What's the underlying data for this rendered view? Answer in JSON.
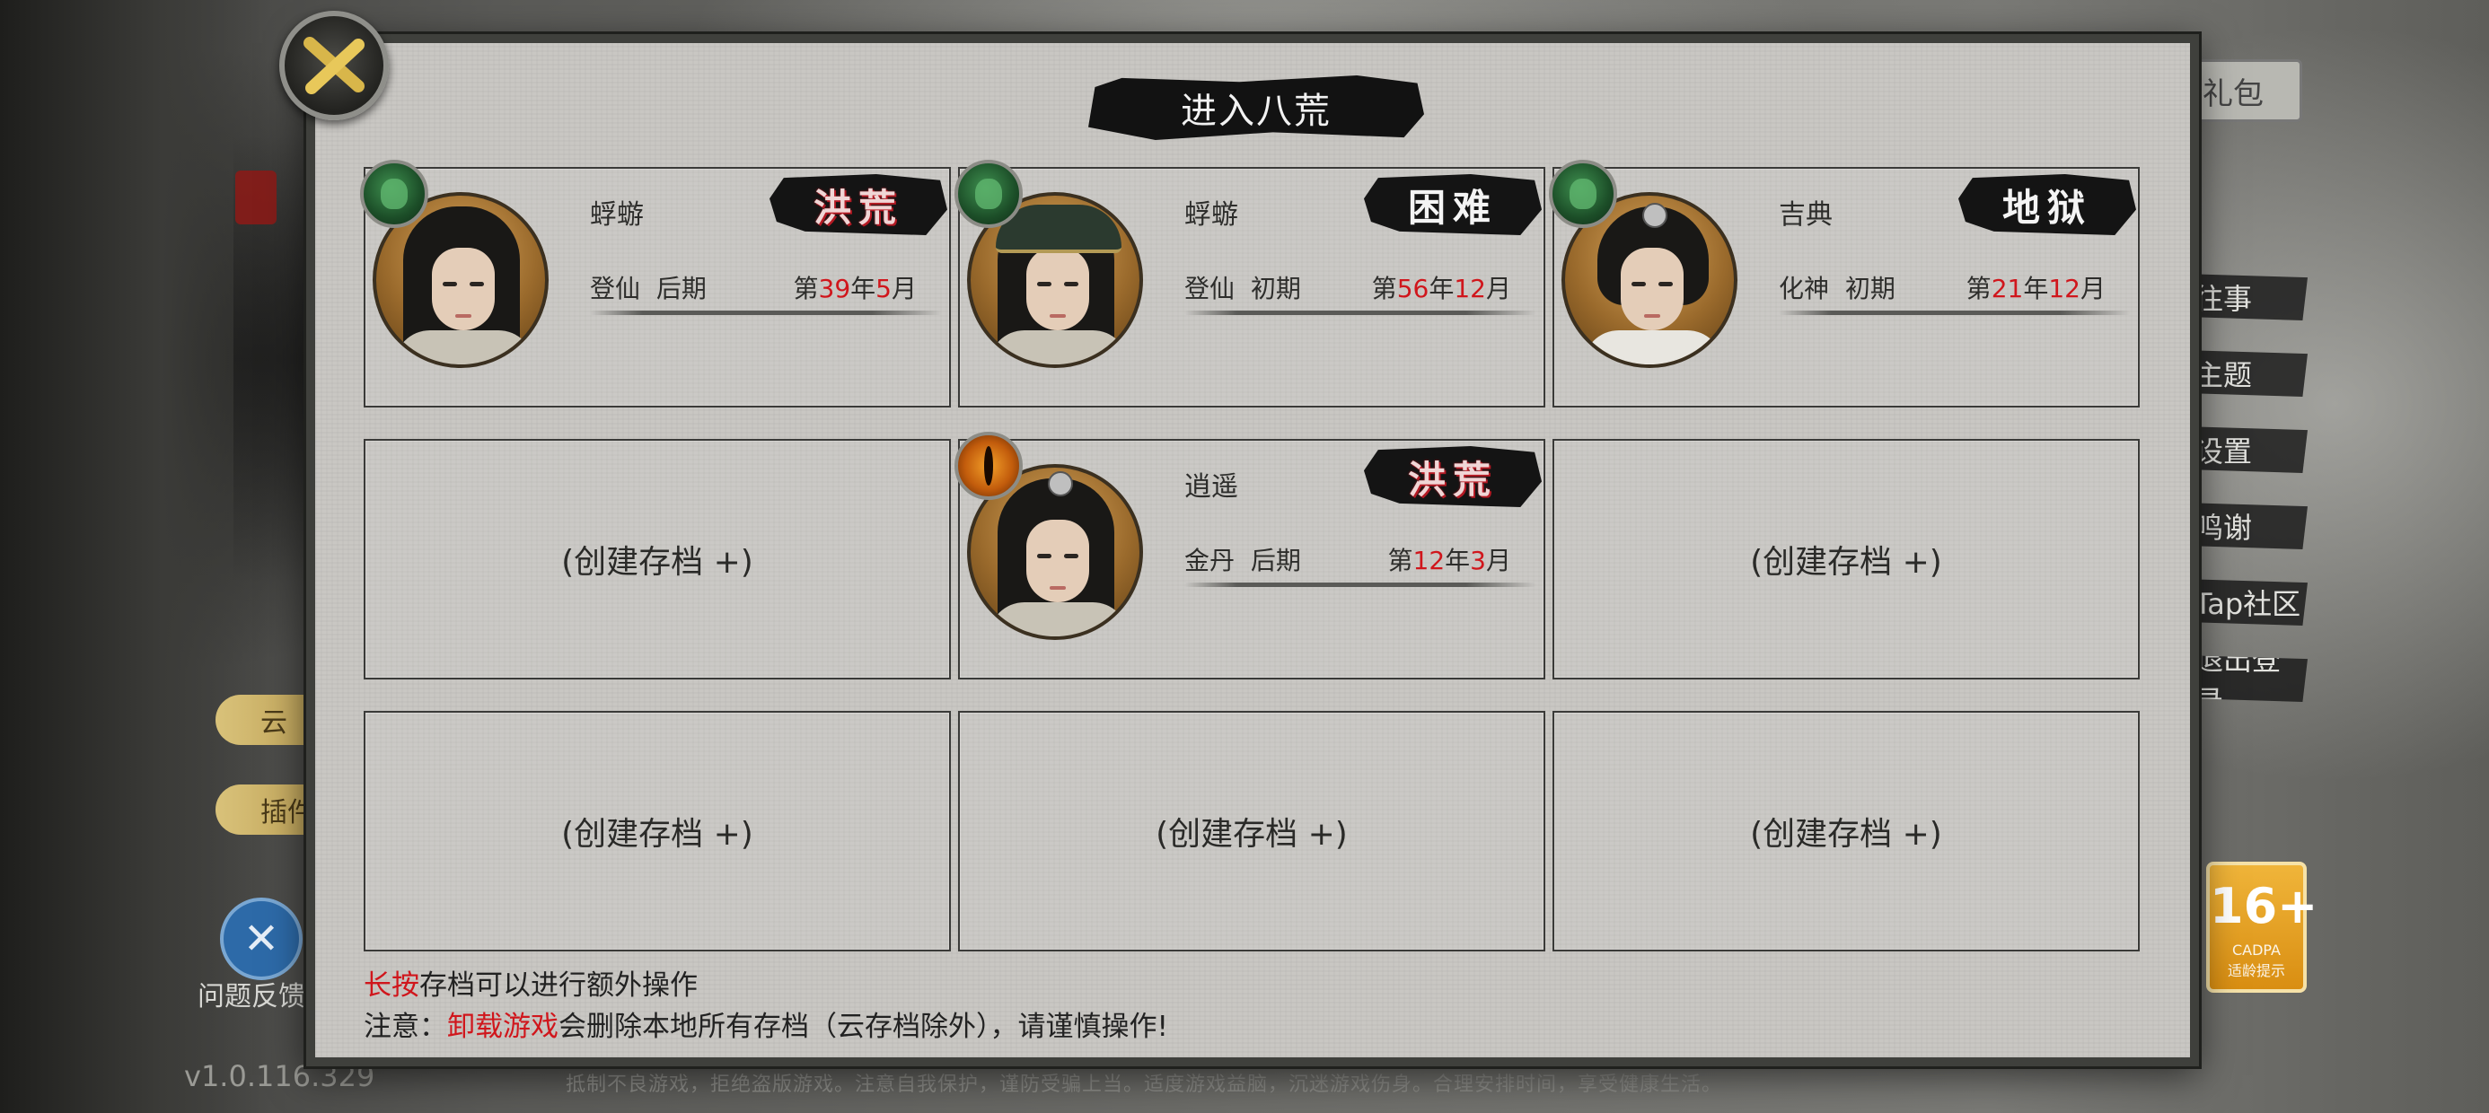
{
  "dialog": {
    "title": "进入八荒",
    "close_icon": "close-x-icon"
  },
  "slots": [
    {
      "filled": true,
      "name": "蜉蝣",
      "difficulty": "洪荒",
      "difficulty_color": "red",
      "realm": "登仙",
      "stage": "后期",
      "date": {
        "prefix": "第",
        "year": "39",
        "year_unit": "年",
        "month": "5",
        "month_unit": "月"
      },
      "gem": "jade-gourd-icon",
      "avatar": "long-hair"
    },
    {
      "filled": true,
      "name": "蜉蝣",
      "difficulty": "困难",
      "difficulty_color": "white",
      "realm": "登仙",
      "stage": "初期",
      "date": {
        "prefix": "第",
        "year": "56",
        "year_unit": "年",
        "month": "12",
        "month_unit": "月"
      },
      "gem": "jade-gourd-icon",
      "avatar": "hat"
    },
    {
      "filled": true,
      "name": "吉典",
      "difficulty": "地狱",
      "difficulty_color": "white",
      "realm": "化神",
      "stage": "初期",
      "date": {
        "prefix": "第",
        "year": "21",
        "year_unit": "年",
        "month": "12",
        "month_unit": "月"
      },
      "gem": "jade-gourd-icon",
      "avatar": "short-hair"
    },
    {
      "filled": false,
      "label": "(创建存档 +)"
    },
    {
      "filled": true,
      "name": "逍遥",
      "difficulty": "洪荒",
      "difficulty_color": "red",
      "realm": "金丹",
      "stage": "后期",
      "date": {
        "prefix": "第",
        "year": "12",
        "year_unit": "年",
        "month": "3",
        "month_unit": "月"
      },
      "gem": "dragon-eye-icon",
      "avatar": "topknot"
    },
    {
      "filled": false,
      "label": "(创建存档 +)"
    },
    {
      "filled": false,
      "label": "(创建存档 +)"
    },
    {
      "filled": false,
      "label": "(创建存档 +)"
    },
    {
      "filled": false,
      "label": "(创建存档 +)"
    }
  ],
  "footer": {
    "line1_red": "长按",
    "line1_rest": "存档可以进行额外操作",
    "line2_prefix": "注意：",
    "line2_red": "卸载游戏",
    "line2_rest": "会删除本地所有存档（云存档除外），请谨慎操作!"
  },
  "background": {
    "top_right_button": "礼包",
    "right_menu": [
      "往事",
      "主题",
      "设置",
      "鸣谢",
      "Tap社区",
      "退出登录"
    ],
    "side_pills": [
      "云",
      "插件"
    ],
    "feedback_label": "问题反馈",
    "feedback_icon": "wrench-screwdriver-icon",
    "version": "v1.0.116.329",
    "age_badge": {
      "age": "16+",
      "line1": "CADPA",
      "line2": "适龄提示"
    },
    "bottom_notice": "抵制不良游戏，拒绝盗版游戏。注意自我保护，谨防受骗上当。适度游戏益脑，沉迷游戏伤身。合理安排时间，享受健康生活。"
  },
  "colors": {
    "accent_red": "#d0161c",
    "panel": "#c9c7c3",
    "frame": "#3f403c"
  }
}
